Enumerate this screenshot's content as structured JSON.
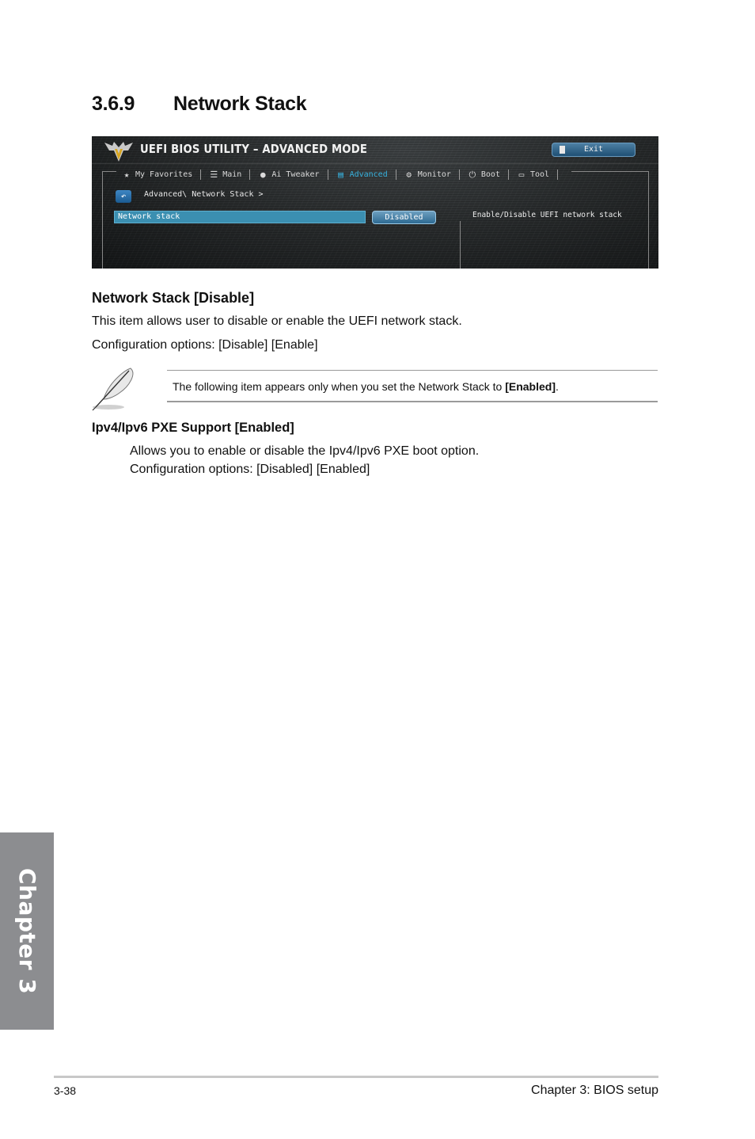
{
  "section": {
    "number": "3.6.9",
    "title": "Network Stack"
  },
  "bios": {
    "title": "UEFI BIOS UTILITY – ADVANCED MODE",
    "exit_label": "Exit",
    "nav": [
      {
        "label": "My Favorites",
        "icon": "star-icon",
        "active": false
      },
      {
        "label": "Main",
        "icon": "list-icon",
        "active": false
      },
      {
        "label": "Ai Tweaker",
        "icon": "tweaker-icon",
        "active": false
      },
      {
        "label": "Advanced",
        "icon": "advanced-icon",
        "active": true
      },
      {
        "label": "Monitor",
        "icon": "monitor-icon",
        "active": false
      },
      {
        "label": "Boot",
        "icon": "power-icon",
        "active": false
      },
      {
        "label": "Tool",
        "icon": "tool-icon",
        "active": false
      }
    ],
    "breadcrumb": "Advanced\\ Network Stack >",
    "setting": {
      "label": "Network stack",
      "value": "Disabled"
    },
    "help_text": "Enable/Disable UEFI network stack",
    "colors": {
      "accent": "#37b3e0",
      "selected_row": "#3b8fb1"
    }
  },
  "item1": {
    "heading": "Network Stack [Disable]",
    "description": "This item allows user to disable or enable the UEFI network stack.",
    "options": "Configuration options: [Disable] [Enable]"
  },
  "note": {
    "text_before": "The following item appears only when you set the Network Stack to ",
    "text_bold": "[Enabled]",
    "text_after": "."
  },
  "item2": {
    "heading": "Ipv4/Ipv6 PXE Support [Enabled]",
    "description": "Allows you to enable or disable the Ipv4/Ipv6 PXE boot option.",
    "options": "Configuration options: [Disabled] [Enabled]"
  },
  "chapter_tab": "Chapter 3",
  "footer": {
    "page": "3-38",
    "chapter": "Chapter 3: BIOS setup"
  }
}
